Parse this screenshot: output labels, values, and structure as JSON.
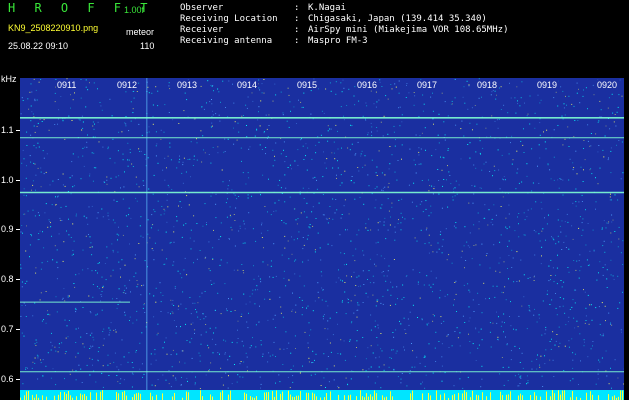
{
  "header": {
    "app_title": "H R O F F T",
    "version": "1.00f",
    "file_name": "KN9_2508220910.png",
    "mode_label": "meteor",
    "date_time": "25.08.22 09:10",
    "mode_value": "110"
  },
  "metadata": [
    {
      "key": "Observer",
      "value": "K.Nagai"
    },
    {
      "key": "Receiving Location",
      "value": "Chigasaki, Japan (139.414 35.340)"
    },
    {
      "key": "Receiver",
      "value": "AirSpy mini (Miakejima VOR 108.65MHz)"
    },
    {
      "key": "Receiving antenna",
      "value": "Maspro FM-3"
    }
  ],
  "spectrogram": {
    "y_unit": "kHz",
    "y_ticks": [
      "1.1",
      "1.0",
      "0.9",
      "0.8",
      "0.7",
      "0.6"
    ],
    "x_ticks": [
      "0911",
      "0912",
      "0913",
      "0914",
      "0915",
      "0916",
      "0917",
      "0918",
      "0919",
      "0920"
    ],
    "background_color": "#1a2fa0",
    "signal_color": "#7fffd4",
    "noise_color": "#00ffff",
    "bottom_band_color": "#00e5ff",
    "carrier_lines_khz": [
      1.12,
      1.08,
      0.97,
      0.75,
      0.61
    ]
  }
}
